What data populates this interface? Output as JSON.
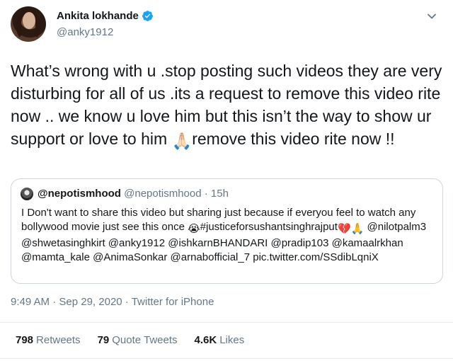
{
  "author": {
    "name": "Ankita lokhande",
    "handle": "@anky1912"
  },
  "tweet": {
    "text_part1": "What’s wrong with u .stop posting such videos they are very disturbing for all of us .its a request to remove this video rite now .. we know u love him but this isn’t the way to show ur support or love to him ",
    "text_part2": "remove this video rite now !!",
    "emoji_praying": "🙏🏻"
  },
  "quoted": {
    "name": "@nepotismhood",
    "handle": "@nepotismhood",
    "time": "· 15h",
    "text_part1": "I Don't want to share this video but sharing just because if everyou feel to watch any bollywood movie just see this once ",
    "emoji_crying": "😭",
    "text_part2": "#justiceforsushantsinghrajput",
    "emoji_broken_heart": "💔",
    "emoji_praying": "🙏",
    "text_part3": " @nilotpalm3 @shwetasinghkirt @anky1912 @ishkarnBHANDARI @pradip103 @kamaalrkhan @mamta_kale @AnimaSonkar @arnabofficial_7 pic.twitter.com/SSdibLqniX"
  },
  "meta": {
    "time": "9:49 AM",
    "date": "Sep 29, 2020",
    "source": "Twitter for iPhone",
    "separator1": " · ",
    "separator2": " · "
  },
  "stats": {
    "retweets_count": "798",
    "retweets_label": "Retweets",
    "quotes_count": "79",
    "quotes_label": "Quote Tweets",
    "likes_count": "4.6K",
    "likes_label": "Likes"
  },
  "colors": {
    "text": "#14171a",
    "secondary": "#657786",
    "verified": "#1da1f2",
    "border": "#ccd6dd"
  }
}
